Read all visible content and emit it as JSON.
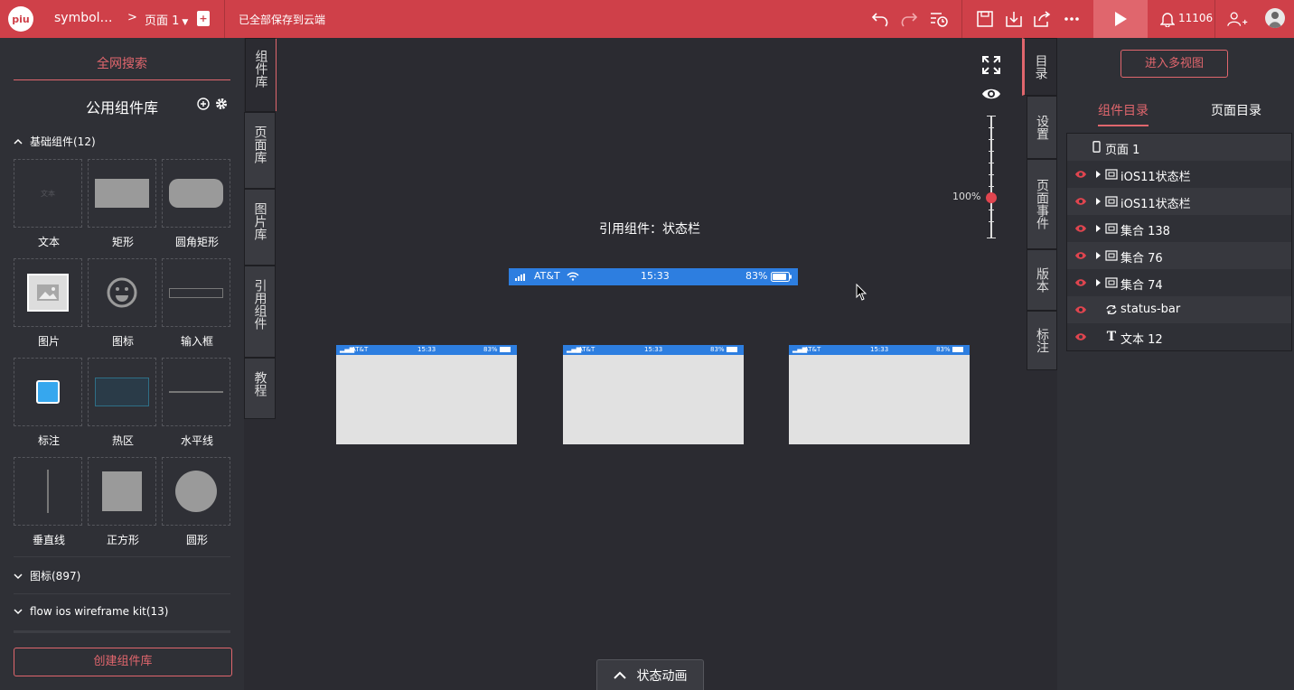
{
  "topbar": {
    "logo": "piu",
    "project_name": "symbol…",
    "crumb_sep": ">",
    "page_name": "页面 1",
    "save_status": "已全部保存到云端",
    "notifications": "11106"
  },
  "left_panel": {
    "global_search": "全网搜索",
    "library_title": "公用组件库",
    "basic_section": "基础组件(12)",
    "components": [
      {
        "label": "文本",
        "icon": "text-icon"
      },
      {
        "label": "矩形",
        "icon": "rect-icon"
      },
      {
        "label": "圆角矩形",
        "icon": "rounded-rect-icon"
      },
      {
        "label": "图片",
        "icon": "image-icon"
      },
      {
        "label": "图标",
        "icon": "smiley-icon"
      },
      {
        "label": "输入框",
        "icon": "input-icon"
      },
      {
        "label": "标注",
        "icon": "annotation-icon"
      },
      {
        "label": "热区",
        "icon": "hotspot-icon"
      },
      {
        "label": "水平线",
        "icon": "hline-icon"
      },
      {
        "label": "垂直线",
        "icon": "vline-icon"
      },
      {
        "label": "正方形",
        "icon": "square-icon"
      },
      {
        "label": "圆形",
        "icon": "circle-icon"
      }
    ],
    "text_placeholder": "文本",
    "icons_section": "图标(897)",
    "flow_section": "flow ios wireframe kit(13)",
    "create_button": "创建组件库"
  },
  "left_tabs": [
    "组件库",
    "页面库",
    "图片库",
    "引用组件",
    "教程"
  ],
  "canvas": {
    "ref_title": "引用组件：状态栏",
    "statusbar": {
      "carrier": "AT&T",
      "time": "15:33",
      "battery": "83%"
    },
    "zoom": "100%",
    "bottom_tab": "状态动画"
  },
  "right_tabs": [
    "目录",
    "设置",
    "页面事件",
    "版本",
    "标注"
  ],
  "right_panel": {
    "multi_view_button": "进入多视图",
    "tab_components": "组件目录",
    "tab_pages": "页面目录",
    "tree": [
      {
        "label": "页面 1",
        "type": "page"
      },
      {
        "label": "iOS11状态栏",
        "type": "group"
      },
      {
        "label": "iOS11状态栏",
        "type": "group"
      },
      {
        "label": "集合 138",
        "type": "group"
      },
      {
        "label": "集合 76",
        "type": "group"
      },
      {
        "label": "集合 74",
        "type": "group"
      },
      {
        "label": "status-bar",
        "type": "symbol"
      },
      {
        "label": "文本 12",
        "type": "text"
      }
    ]
  },
  "colors": {
    "brand": "#cf4049",
    "accent": "#e0666d",
    "statusbar": "#2d7ee0"
  }
}
